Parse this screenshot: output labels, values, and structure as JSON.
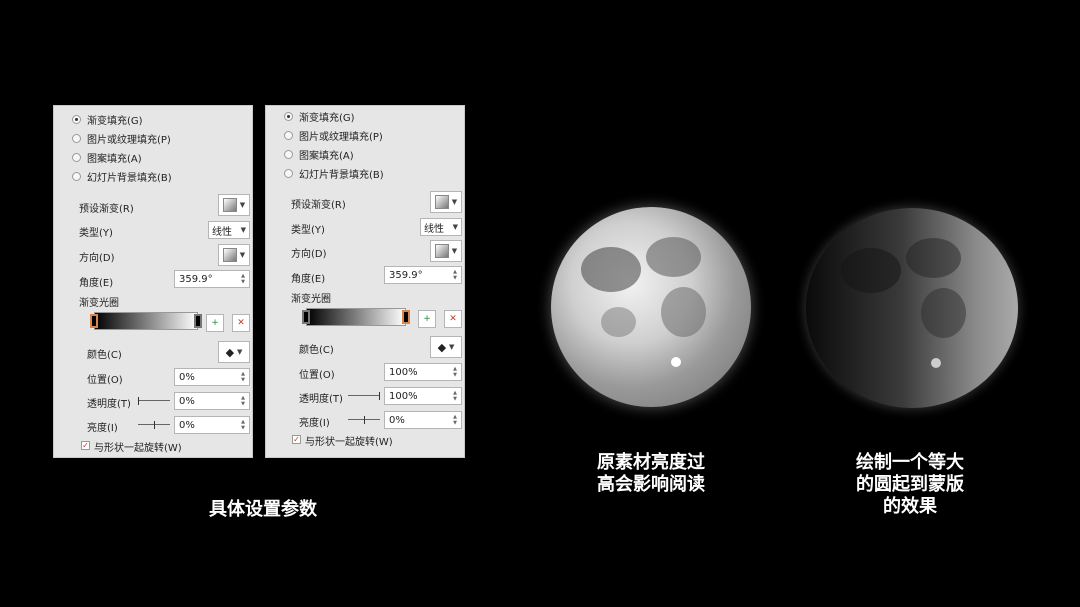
{
  "panels": [
    {
      "fill_options": [
        "渐变填充(G)",
        "图片或纹理填充(P)",
        "图案填充(A)",
        "幻灯片背景填充(B)"
      ],
      "checked_index": 0,
      "preset_label": "预设渐变(R)",
      "type_label": "类型(Y)",
      "type_value": "线性",
      "direction_label": "方向(D)",
      "angle_label": "角度(E)",
      "angle_value": "359.9°",
      "stops_label": "渐变光圈",
      "color_label": "颜色(C)",
      "position_label": "位置(O)",
      "position_value": "0%",
      "transparency_label": "透明度(T)",
      "transparency_value": "0%",
      "brightness_label": "亮度(I)",
      "brightness_value": "0%",
      "rotate_label": "与形状一起旋转(W)",
      "selected_stop": "left"
    },
    {
      "fill_options": [
        "渐变填充(G)",
        "图片或纹理填充(P)",
        "图案填充(A)",
        "幻灯片背景填充(B)"
      ],
      "checked_index": 0,
      "preset_label": "预设渐变(R)",
      "type_label": "类型(Y)",
      "type_value": "线性",
      "direction_label": "方向(D)",
      "angle_label": "角度(E)",
      "angle_value": "359.9°",
      "stops_label": "渐变光圈",
      "color_label": "颜色(C)",
      "position_label": "位置(O)",
      "position_value": "100%",
      "transparency_label": "透明度(T)",
      "transparency_value": "100%",
      "brightness_label": "亮度(I)",
      "brightness_value": "0%",
      "rotate_label": "与形状一起旋转(W)",
      "selected_stop": "right"
    }
  ],
  "captions": {
    "settings": "具体设置参数",
    "original": "原素材亮度过\n高会影响阅读",
    "masked": "绘制一个等大\n的圆起到蒙版\n的效果"
  },
  "colors": {
    "background": "#000000",
    "panel": "#e6e6e6",
    "stop_highlight": "#d8864a"
  }
}
